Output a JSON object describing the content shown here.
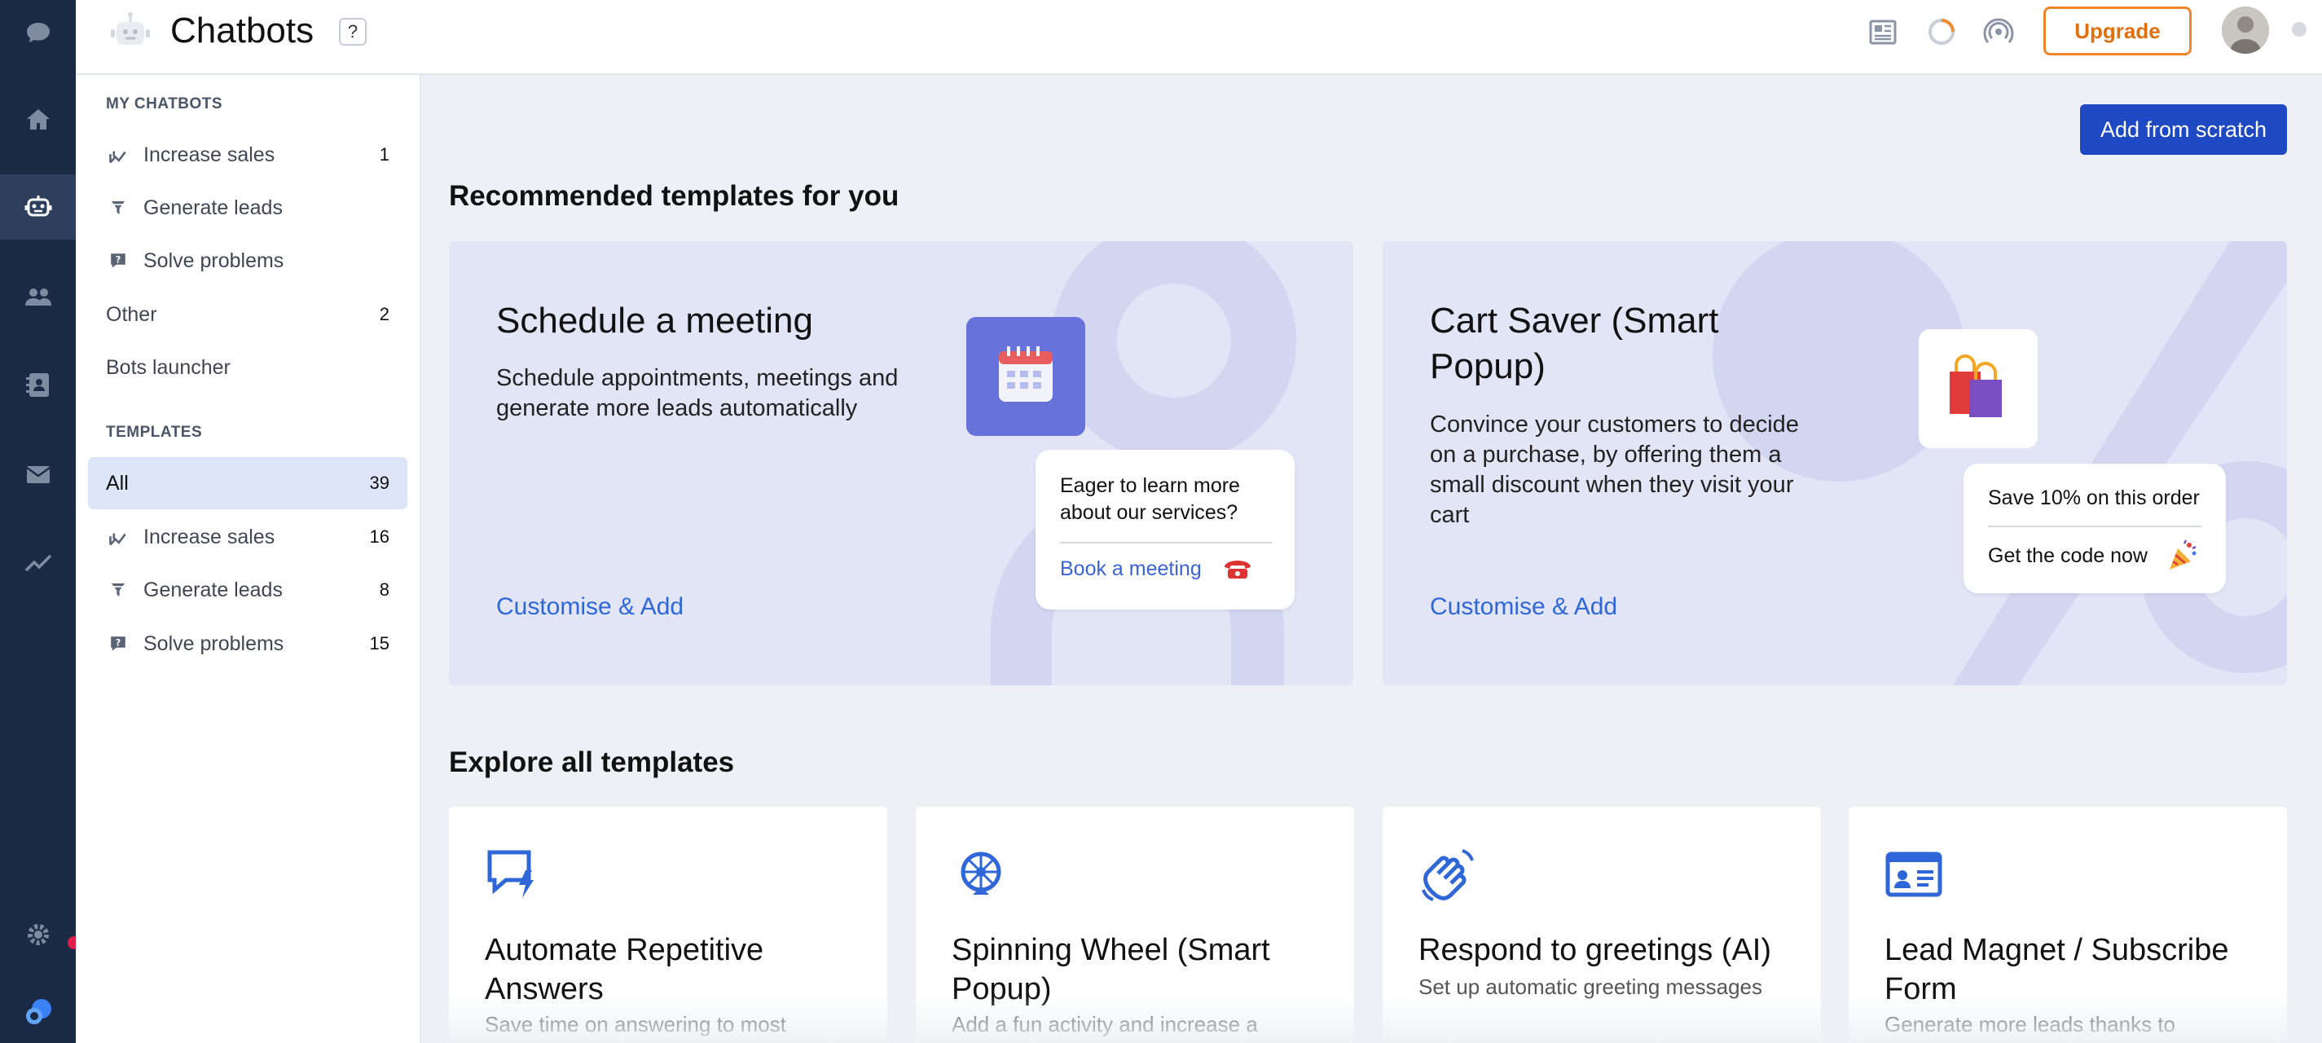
{
  "app": {
    "title": "Chatbots",
    "help": "?"
  },
  "topbar": {
    "upgrade_label": "Upgrade"
  },
  "sidebar": {
    "my_chatbots_heading": "MY CHATBOTS",
    "my_chatbots": [
      {
        "label": "Increase sales",
        "count": "1",
        "icon": "chart-icon"
      },
      {
        "label": "Generate leads",
        "count": "",
        "icon": "funnel-icon"
      },
      {
        "label": "Solve problems",
        "count": "",
        "icon": "question-bubble-icon"
      },
      {
        "label": "Other",
        "count": "2"
      },
      {
        "label": "Bots launcher",
        "count": ""
      }
    ],
    "templates_heading": "TEMPLATES",
    "templates": [
      {
        "label": "All",
        "count": "39",
        "active": true
      },
      {
        "label": "Increase sales",
        "count": "16",
        "icon": "chart-icon"
      },
      {
        "label": "Generate leads",
        "count": "8",
        "icon": "funnel-icon"
      },
      {
        "label": "Solve problems",
        "count": "15",
        "icon": "question-bubble-icon"
      }
    ]
  },
  "main": {
    "add_label": "Add from scratch",
    "recommended_heading": "Recommended templates for you",
    "recommended": [
      {
        "title": "Schedule a meeting",
        "description": "Schedule appointments, meetings and generate more leads automatically",
        "link": "Customise & Add",
        "bubble_question": "Eager to learn more about our services?",
        "bubble_action": "Book a meeting",
        "icon": "calendar-icon"
      },
      {
        "title": "Cart Saver (Smart Popup)",
        "description": "Convince your customers to decide on a purchase, by offering them a small discount when they visit your cart",
        "link": "Customise & Add",
        "bubble_line1": "Save 10% on this order",
        "bubble_line2": "Get the code now",
        "icon": "shopping-bags-icon"
      }
    ],
    "explore_heading": "Explore all templates",
    "templates": [
      {
        "title": "Automate Repetitive Answers",
        "description": "Save time on answering to most",
        "icon": "chat-bolt-icon"
      },
      {
        "title": "Spinning Wheel (Smart Popup)",
        "description": "Add a fun activity and increase a",
        "icon": "spinning-wheel-icon"
      },
      {
        "title": "Respond to greetings (AI)",
        "description": "Set up automatic greeting messages",
        "icon": "waving-hand-icon"
      },
      {
        "title": "Lead Magnet / Subscribe Form",
        "description": "Generate more leads thanks to",
        "icon": "contact-card-icon"
      }
    ]
  },
  "colors": {
    "rail": "#1b2b45",
    "accent": "#1e49c2",
    "link": "#2f67d8",
    "upgrade": "#f0862b"
  }
}
